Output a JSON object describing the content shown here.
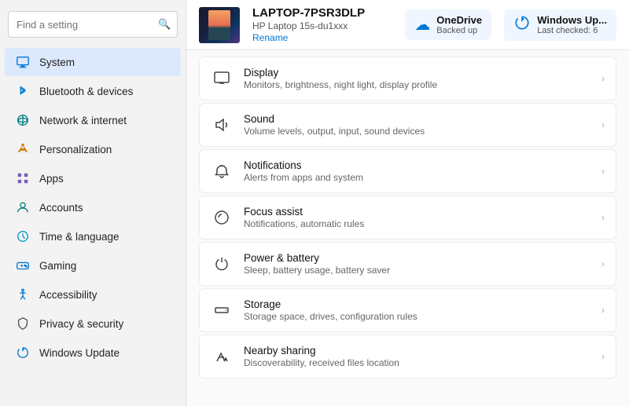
{
  "sidebar": {
    "search_placeholder": "Find a setting",
    "search_icon": "🔍",
    "items": [
      {
        "id": "system",
        "label": "System",
        "icon": "🖥",
        "color": "blue",
        "active": true
      },
      {
        "id": "bluetooth",
        "label": "Bluetooth & devices",
        "icon": "⬡",
        "color": "blue",
        "active": false
      },
      {
        "id": "network",
        "label": "Network & internet",
        "icon": "🌐",
        "color": "teal",
        "active": false
      },
      {
        "id": "personalization",
        "label": "Personalization",
        "icon": "🖌",
        "color": "orange",
        "active": false
      },
      {
        "id": "apps",
        "label": "Apps",
        "icon": "☰",
        "color": "purple",
        "active": false
      },
      {
        "id": "accounts",
        "label": "Accounts",
        "icon": "👤",
        "color": "teal",
        "active": false
      },
      {
        "id": "time",
        "label": "Time & language",
        "icon": "🌍",
        "color": "cyan",
        "active": false
      },
      {
        "id": "gaming",
        "label": "Gaming",
        "icon": "🎮",
        "color": "blue",
        "active": false
      },
      {
        "id": "accessibility",
        "label": "Accessibility",
        "icon": "♿",
        "color": "blue",
        "active": false
      },
      {
        "id": "privacy",
        "label": "Privacy & security",
        "icon": "🛡",
        "color": "gray",
        "active": false
      },
      {
        "id": "update",
        "label": "Windows Update",
        "icon": "⟳",
        "color": "blue",
        "active": false
      }
    ]
  },
  "header": {
    "device_name": "LAPTOP-7PSR3DLP",
    "device_model": "HP Laptop 15s-du1xxx",
    "rename_label": "Rename",
    "onedrive_label": "OneDrive",
    "onedrive_status": "Backed up",
    "update_label": "Windows Up...",
    "update_status": "Last checked: 6"
  },
  "settings": {
    "items": [
      {
        "id": "display",
        "title": "Display",
        "subtitle": "Monitors, brightness, night light, display profile"
      },
      {
        "id": "sound",
        "title": "Sound",
        "subtitle": "Volume levels, output, input, sound devices"
      },
      {
        "id": "notifications",
        "title": "Notifications",
        "subtitle": "Alerts from apps and system"
      },
      {
        "id": "focus",
        "title": "Focus assist",
        "subtitle": "Notifications, automatic rules"
      },
      {
        "id": "power",
        "title": "Power & battery",
        "subtitle": "Sleep, battery usage, battery saver"
      },
      {
        "id": "storage",
        "title": "Storage",
        "subtitle": "Storage space, drives, configuration rules"
      },
      {
        "id": "nearby",
        "title": "Nearby sharing",
        "subtitle": "Discoverability, received files location"
      }
    ]
  }
}
